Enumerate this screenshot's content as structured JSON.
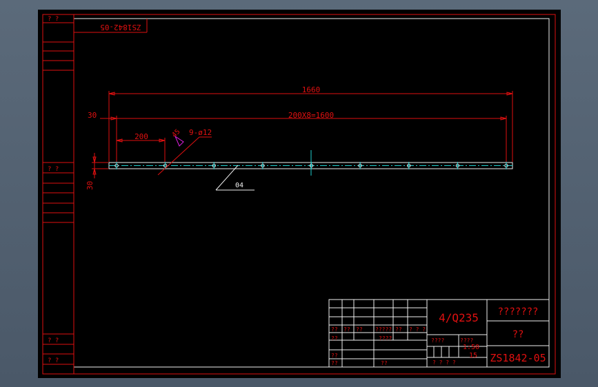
{
  "drawing": {
    "code_mirrored": "ZS1842-05",
    "left_strip": {
      "top": "? ?",
      "mid": "? ?",
      "bot1": "? ?",
      "bot2": "? ?"
    },
    "dims": {
      "overall": "1660",
      "pitch": "200X8=1600",
      "end_offset": "30",
      "first_pitch": "200",
      "height": "30",
      "holes": "9-ø12",
      "chamfer": "45",
      "leader_label": "04",
      "hole_count": 9
    }
  },
  "title_block": {
    "material": "4/Q235",
    "company": "???????",
    "name": "??",
    "drawing_no": "ZS1842-05",
    "scale": "1:50",
    "weight": "15",
    "row_labels": [
      "??",
      "??",
      "??",
      "?????",
      "??",
      "? ? ?"
    ],
    "left_labels": [
      "??",
      "??",
      "??"
    ],
    "mid_labels": [
      "????",
      "??",
      "????"
    ],
    "stage": "????",
    "sheet": "? ?  ? ?"
  }
}
